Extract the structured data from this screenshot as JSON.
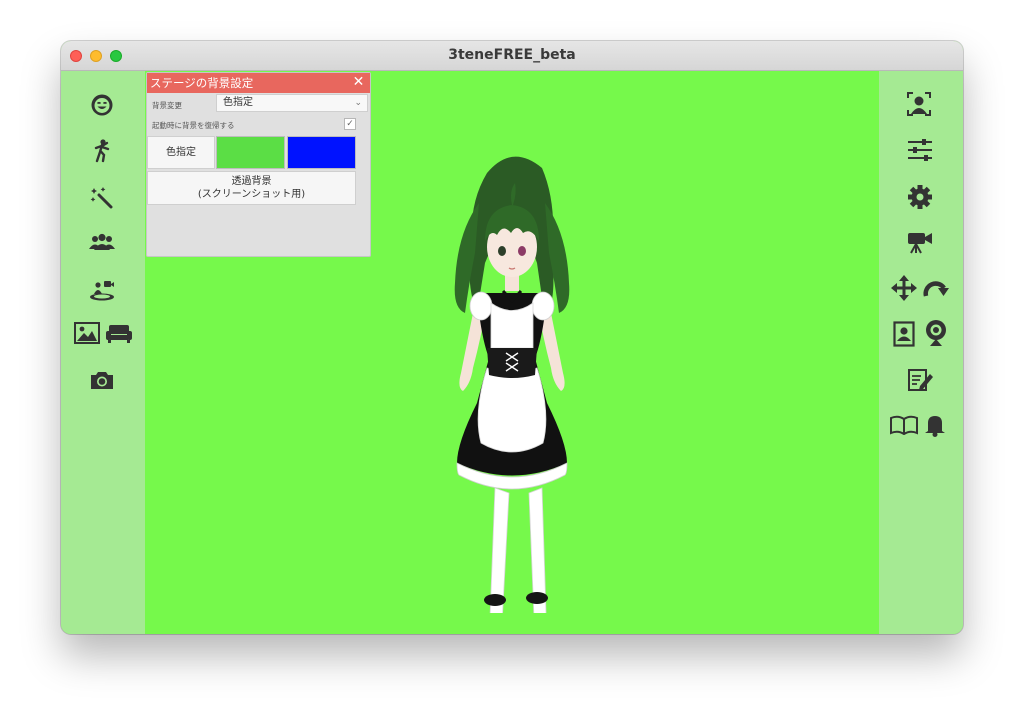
{
  "window": {
    "title": "3teneFREE_beta"
  },
  "colors": {
    "stage_bg": "#76f94b",
    "sidebar_bg": "#a5ea93",
    "dialog_header": "#e8675e",
    "swatch_green": "#5bde45",
    "swatch_blue": "#0012ff"
  },
  "left_toolbar": [
    {
      "icon": "face-icon"
    },
    {
      "icon": "pose-figure-icon"
    },
    {
      "icon": "magic-wand-icon"
    },
    {
      "icon": "group-people-icon"
    },
    {
      "icon": "stage-camera-icon"
    },
    {
      "icon": "background-image-icon"
    },
    {
      "icon": "sofa-icon"
    },
    {
      "icon": "camera-icon"
    }
  ],
  "right_toolbar": [
    {
      "icon": "face-tracking-icon"
    },
    {
      "icon": "sliders-icon"
    },
    {
      "icon": "gear-icon"
    },
    {
      "icon": "video-camera-icon"
    },
    {
      "icon": "move-arrows-icon"
    },
    {
      "icon": "rotate-arrow-icon"
    },
    {
      "icon": "profile-card-icon"
    },
    {
      "icon": "webcam-icon"
    },
    {
      "icon": "notes-edit-icon"
    },
    {
      "icon": "book-icon"
    },
    {
      "icon": "bell-icon"
    }
  ],
  "background_dialog": {
    "title": "ステージの背景設定",
    "close_label": "✕",
    "bg_change_label": "背景変更",
    "bg_change_value": "色指定",
    "restore_label": "起動時に背景を復帰する",
    "restore_checked": true,
    "color_button_label": "色指定",
    "transparent_line1": "透過背景",
    "transparent_line2": "(スクリーンショット用)"
  }
}
